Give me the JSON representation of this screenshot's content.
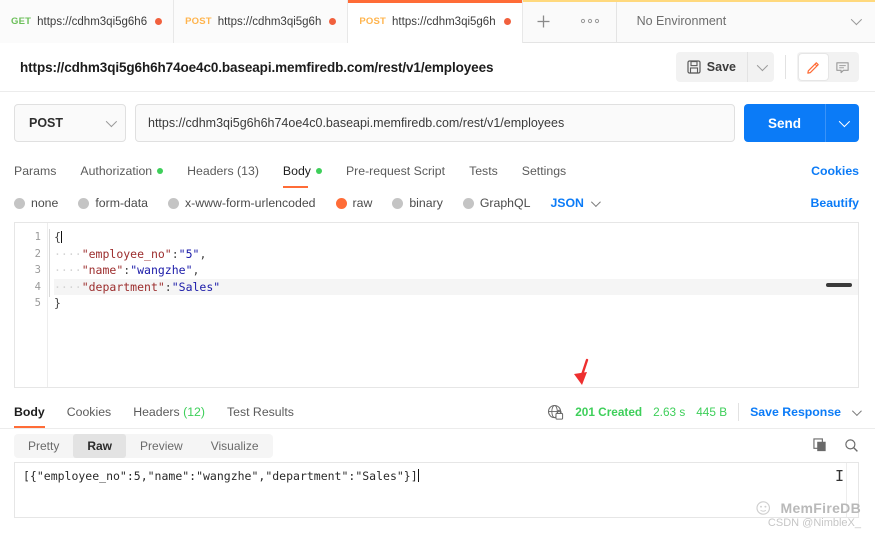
{
  "tabbar": {
    "tabs": [
      {
        "method": "GET",
        "url": "https://cdhm3qi5g6h6",
        "unsaved": true,
        "active": false
      },
      {
        "method": "POST",
        "url": "https://cdhm3qi5g6h",
        "unsaved": true,
        "active": false
      },
      {
        "method": "POST",
        "url": "https://cdhm3qi5g6h",
        "unsaved": true,
        "active": true
      }
    ],
    "new_tab_icon": "plus-icon",
    "more_icon": "ellipsis-icon",
    "environment": "No Environment"
  },
  "request_header": {
    "title": "https://cdhm3qi5g6h6h74oe4c0.baseapi.memfiredb.com/rest/v1/employees",
    "save_label": "Save",
    "save_icon": "floppy-disk-icon",
    "save_caret_icon": "chevron-down-icon",
    "edit_icon": "pencil-icon",
    "comment_icon": "comment-icon"
  },
  "url_bar": {
    "method": "POST",
    "method_caret_icon": "chevron-down-icon",
    "url": "https://cdhm3qi5g6h6h74oe4c0.baseapi.memfiredb.com/rest/v1/employees",
    "send_label": "Send",
    "send_caret_icon": "chevron-down-icon"
  },
  "request_tabs": {
    "items": [
      {
        "label": "Params",
        "dot": false,
        "active": false
      },
      {
        "label": "Authorization",
        "dot": true,
        "active": false
      },
      {
        "label": "Headers (13)",
        "dot": false,
        "active": false
      },
      {
        "label": "Body",
        "dot": true,
        "active": true
      },
      {
        "label": "Pre-request Script",
        "dot": false,
        "active": false
      },
      {
        "label": "Tests",
        "dot": false,
        "active": false
      },
      {
        "label": "Settings",
        "dot": false,
        "active": false
      }
    ],
    "cookies_label": "Cookies"
  },
  "body_type": {
    "options": [
      {
        "label": "none",
        "selected": false
      },
      {
        "label": "form-data",
        "selected": false
      },
      {
        "label": "x-www-form-urlencoded",
        "selected": false
      },
      {
        "label": "raw",
        "selected": true
      },
      {
        "label": "binary",
        "selected": false
      },
      {
        "label": "GraphQL",
        "selected": false
      }
    ],
    "format": "JSON",
    "format_caret_icon": "chevron-down-icon",
    "beautify_label": "Beautify"
  },
  "editor": {
    "line_numbers": [
      "1",
      "2",
      "3",
      "4",
      "5"
    ],
    "lines": [
      {
        "indent": "",
        "text": "{",
        "type": "punct"
      },
      {
        "indent": "····",
        "key": "\"employee_no\"",
        "value": "\"5\"",
        "tail": ","
      },
      {
        "indent": "····",
        "key": "\"name\"",
        "value": "\"wangzhe\"",
        "tail": ","
      },
      {
        "indent": "····",
        "key": "\"department\"",
        "value": "\"Sales\"",
        "tail": ""
      },
      {
        "indent": "",
        "text": "}",
        "type": "punct"
      }
    ]
  },
  "response": {
    "tabs": [
      {
        "label": "Body",
        "count": "",
        "active": true
      },
      {
        "label": "Cookies",
        "count": "",
        "active": false
      },
      {
        "label": "Headers",
        "count": "(12)",
        "active": false
      },
      {
        "label": "Test Results",
        "count": "",
        "active": false
      }
    ],
    "network_icon": "globe-lock-icon",
    "status": "201 Created",
    "time": "2.63 s",
    "size": "445 B",
    "save_response_label": "Save Response",
    "save_response_caret_icon": "chevron-down-icon",
    "view_modes": [
      {
        "label": "Pretty",
        "selected": false
      },
      {
        "label": "Raw",
        "selected": true
      },
      {
        "label": "Preview",
        "selected": false
      },
      {
        "label": "Visualize",
        "selected": false
      }
    ],
    "copy_icon": "copy-icon",
    "search_icon": "search-icon",
    "body_text": "[{\"employee_no\":5,\"name\":\"wangzhe\",\"department\":\"Sales\"}]"
  },
  "annotation": {
    "arrow_color": "#ee2f2f",
    "arrow_name": "red-pointer-arrow"
  },
  "watermark": {
    "brand": "MemFireDB",
    "credit": "CSDN @NimbleX_"
  },
  "colors": {
    "accent_orange": "#ff6c37",
    "link_blue": "#0b7bf7",
    "success_green": "#3ecf5a",
    "unsaved_dot": "#f1603d"
  }
}
